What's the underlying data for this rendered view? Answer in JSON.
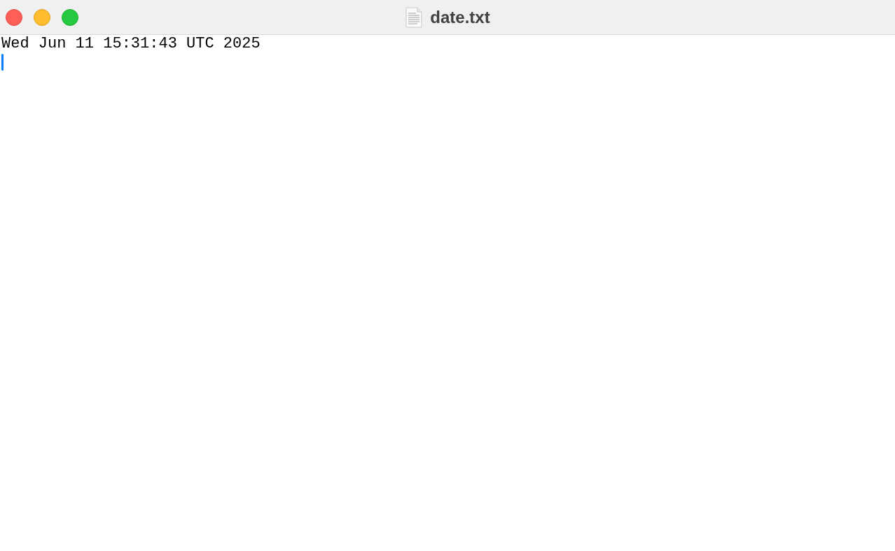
{
  "window": {
    "title": "date.txt"
  },
  "document": {
    "lines": [
      "Wed Jun 11 15:31:43 UTC 2025"
    ]
  }
}
